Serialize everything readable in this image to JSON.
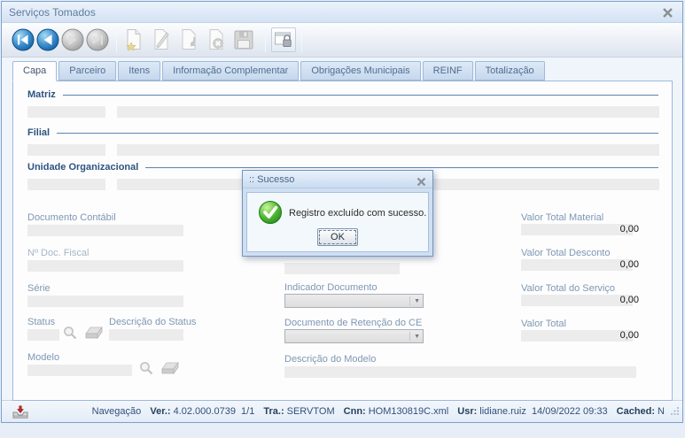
{
  "window": {
    "title": "Serviços Tomados"
  },
  "toolbar": {
    "buttons": [
      {
        "name": "first-record",
        "enabled": true
      },
      {
        "name": "previous-record",
        "enabled": true
      },
      {
        "name": "next-record",
        "enabled": false
      },
      {
        "name": "last-record",
        "enabled": false
      },
      {
        "name": "new-record",
        "enabled": false
      },
      {
        "name": "edit-record",
        "enabled": false
      },
      {
        "name": "undo",
        "enabled": false
      },
      {
        "name": "cancel",
        "enabled": false
      },
      {
        "name": "save",
        "enabled": false
      },
      {
        "name": "lock",
        "enabled": true
      }
    ]
  },
  "tabs": {
    "items": [
      {
        "label": "Capa",
        "active": true
      },
      {
        "label": "Parceiro",
        "active": false
      },
      {
        "label": "Itens",
        "active": false
      },
      {
        "label": "Informação Complementar",
        "active": false
      },
      {
        "label": "Obrigações Municipais",
        "active": false
      },
      {
        "label": "REINF",
        "active": false
      },
      {
        "label": "Totalização",
        "active": false
      }
    ]
  },
  "form": {
    "groups": {
      "matriz": "Matriz",
      "filial": "Filial",
      "unidade_organizacional": "Unidade Organizacional"
    },
    "fields": {
      "documento_contabil": {
        "label": "Documento Contábil",
        "value": ""
      },
      "num_doc_fiscal": {
        "label": "Nº Doc. Fiscal",
        "value": ""
      },
      "serie": {
        "label": "Série",
        "value": ""
      },
      "status": {
        "label": "Status",
        "value": ""
      },
      "descricao_status": {
        "label": "Descrição do Status",
        "value": ""
      },
      "modelo": {
        "label": "Modelo",
        "value": ""
      },
      "indicador_documento": {
        "label": "Indicador Documento",
        "value": ""
      },
      "documento_retencao_ce": {
        "label": "Documento de Retenção do CE",
        "value": ""
      },
      "descricao_modelo": {
        "label": "Descrição do Modelo",
        "value": ""
      },
      "valor_total_material": {
        "label": "Valor Total Material",
        "value": "0,00"
      },
      "valor_total_desconto": {
        "label": "Valor Total Desconto",
        "value": "0,00"
      },
      "valor_total_servico": {
        "label": "Valor Total do Serviço",
        "value": "0,00"
      },
      "valor_total": {
        "label": "Valor Total",
        "value": "0,00"
      }
    }
  },
  "dialog": {
    "title": ":: Sucesso",
    "message": "Registro excluído com sucesso.",
    "ok_label": "OK"
  },
  "statusbar": {
    "mode": "Navegação",
    "ver_label": "Ver.:",
    "ver_value": "4.02.000.0739",
    "page": "1/1",
    "tra_label": "Tra.:",
    "tra_value": "SERVTOM",
    "cnn_label": "Cnn:",
    "cnn_value": "HOM130819C.xml",
    "usr_label": "Usr:",
    "usr_value": "lidiane.ruiz",
    "datetime": "14/09/2022 09:33",
    "cached_label": "Cached:",
    "cached_value": "N"
  },
  "icons": {
    "first-record": "skip-to-start",
    "previous-record": "arrow-left-circle",
    "next-record": "arrow-right-circle",
    "last-record": "skip-to-end",
    "new-record": "page-with-star",
    "edit-record": "pencil-on-page",
    "undo": "page-with-return-arrow",
    "cancel": "page-with-x",
    "save": "floppy-disk",
    "lock": "window-with-padlock",
    "lookup": "magnifier",
    "clear": "eraser",
    "success": "green-check-circle",
    "export": "tray-red-arrow"
  },
  "colors": {
    "accent_blue": "#2e86c9",
    "success_green": "#2f9e2f",
    "window_border": "#7ea0cc",
    "input_bg": "#ececec",
    "group_label": "#2d5380",
    "field_label": "#7e97b2"
  }
}
